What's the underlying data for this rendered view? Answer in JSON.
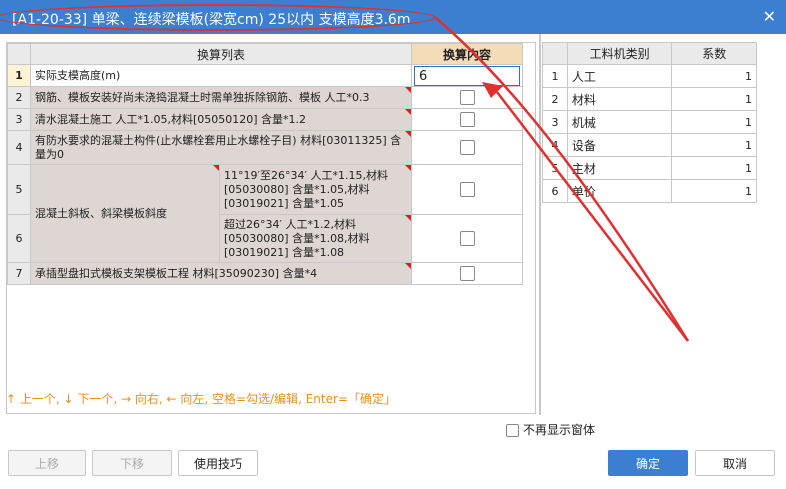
{
  "title": "[A1-20-33] 单梁、连续梁模板(梁宽cm) 25以内 支模高度3.6m",
  "main_table": {
    "headers": [
      "换算列表",
      "换算内容"
    ],
    "rows": [
      {
        "idx": "1",
        "desc": "实际支模高度(m)",
        "value": "6"
      },
      {
        "idx": "2",
        "desc": "钢筋、模板安装好尚未浇捣混凝土时需单独拆除钢筋、模板 人工*0.3"
      },
      {
        "idx": "3",
        "desc": "清水混凝土施工 人工*1.05,材料[05050120] 含量*1.2"
      },
      {
        "idx": "4",
        "desc": "有防水要求的混凝土构件(止水螺栓套用止水螺栓子目) 材料[03011325] 含量为0"
      },
      {
        "idx": "5",
        "group": "混凝土斜板、斜梁模板斜度",
        "desc": "11°19′至26°34′ 人工*1.15,材料[05030080] 含量*1.05,材料[03019021] 含量*1.05"
      },
      {
        "idx": "6",
        "desc": "超过26°34′ 人工*1.2,材料[05030080] 含量*1.08,材料[03019021] 含量*1.08"
      },
      {
        "idx": "7",
        "desc": "承插型盘扣式模板支架模板工程 材料[35090230] 含量*4"
      }
    ]
  },
  "side_table": {
    "headers": [
      "工料机类别",
      "系数"
    ],
    "rows": [
      {
        "idx": "1",
        "name": "人工",
        "value": "1"
      },
      {
        "idx": "2",
        "name": "材料",
        "value": "1"
      },
      {
        "idx": "3",
        "name": "机械",
        "value": "1"
      },
      {
        "idx": "4",
        "name": "设备",
        "value": "1"
      },
      {
        "idx": "5",
        "name": "主材",
        "value": "1"
      },
      {
        "idx": "6",
        "name": "单价",
        "value": "1"
      }
    ]
  },
  "hint": "↑ 上一个, ↓ 下一个, → 向右, ← 向左, 空格=勾选/编辑, Enter=「确定」",
  "buttons": {
    "up": "上移",
    "down": "下移",
    "tips": "使用技巧",
    "no_show": "不再显示窗体",
    "ok": "确定",
    "cancel": "取消"
  },
  "colors": {
    "titlebar": "#3c7fd0",
    "annotation": "#e03030",
    "hint": "#e8911a",
    "row_bg": "#ddd6d2",
    "header_highlight": "#f5dcb8"
  }
}
